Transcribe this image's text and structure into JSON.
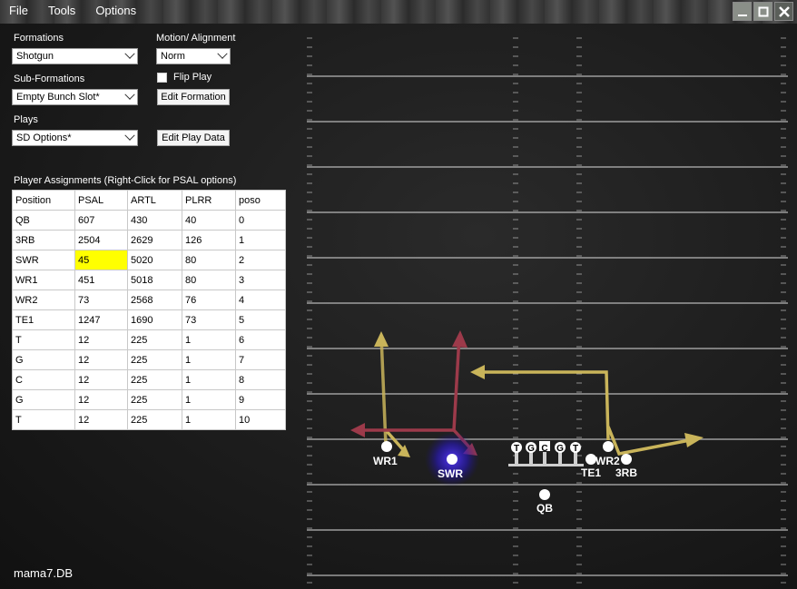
{
  "menu": [
    "File",
    "Tools",
    "Options"
  ],
  "window_buttons": [
    "minimize-icon",
    "maximize-icon",
    "close-icon"
  ],
  "left_panel": {
    "formations_label": "Formations",
    "formations_value": "Shotgun",
    "motion_label": "Motion/ Alignment",
    "motion_value": "Norm",
    "subformations_label": "Sub-Formations",
    "subformations_value": "Empty Bunch Slot*",
    "flip_play_label": "Flip Play",
    "flip_play_checked": false,
    "edit_formation_label": "Edit Formation",
    "plays_label": "Plays",
    "plays_value": "SD Options*",
    "edit_play_data_label": "Edit Play Data",
    "assignments_label": "Player Assignments (Right-Click for PSAL options)"
  },
  "table": {
    "columns": [
      "Position",
      "PSAL",
      "ARTL",
      "PLRR",
      "poso"
    ],
    "rows": [
      [
        "QB",
        "607",
        "430",
        "40",
        "0"
      ],
      [
        "3RB",
        "2504",
        "2629",
        "126",
        "1"
      ],
      [
        "SWR",
        "45",
        "5020",
        "80",
        "2"
      ],
      [
        "WR1",
        "451",
        "5018",
        "80",
        "3"
      ],
      [
        "WR2",
        "73",
        "2568",
        "76",
        "4"
      ],
      [
        "TE1",
        "1247",
        "1690",
        "73",
        "5"
      ],
      [
        "T",
        "12",
        "225",
        "1",
        "6"
      ],
      [
        "G",
        "12",
        "225",
        "1",
        "7"
      ],
      [
        "C",
        "12",
        "225",
        "1",
        "8"
      ],
      [
        "G",
        "12",
        "225",
        "1",
        "9"
      ],
      [
        "T",
        "12",
        "225",
        "1",
        "10"
      ]
    ],
    "highlight_color": "#ffff00"
  },
  "field": {
    "players": [
      "WR1",
      "SWR",
      "TE1",
      "WR2",
      "3RB",
      "QB"
    ],
    "linemen": [
      "T",
      "G",
      "C",
      "G",
      "T"
    ],
    "route_colors": {
      "gold": "#c9b45a",
      "red": "#9c3a4a",
      "selected_glow": "#3a2cff"
    }
  },
  "status": "mama7.DB"
}
